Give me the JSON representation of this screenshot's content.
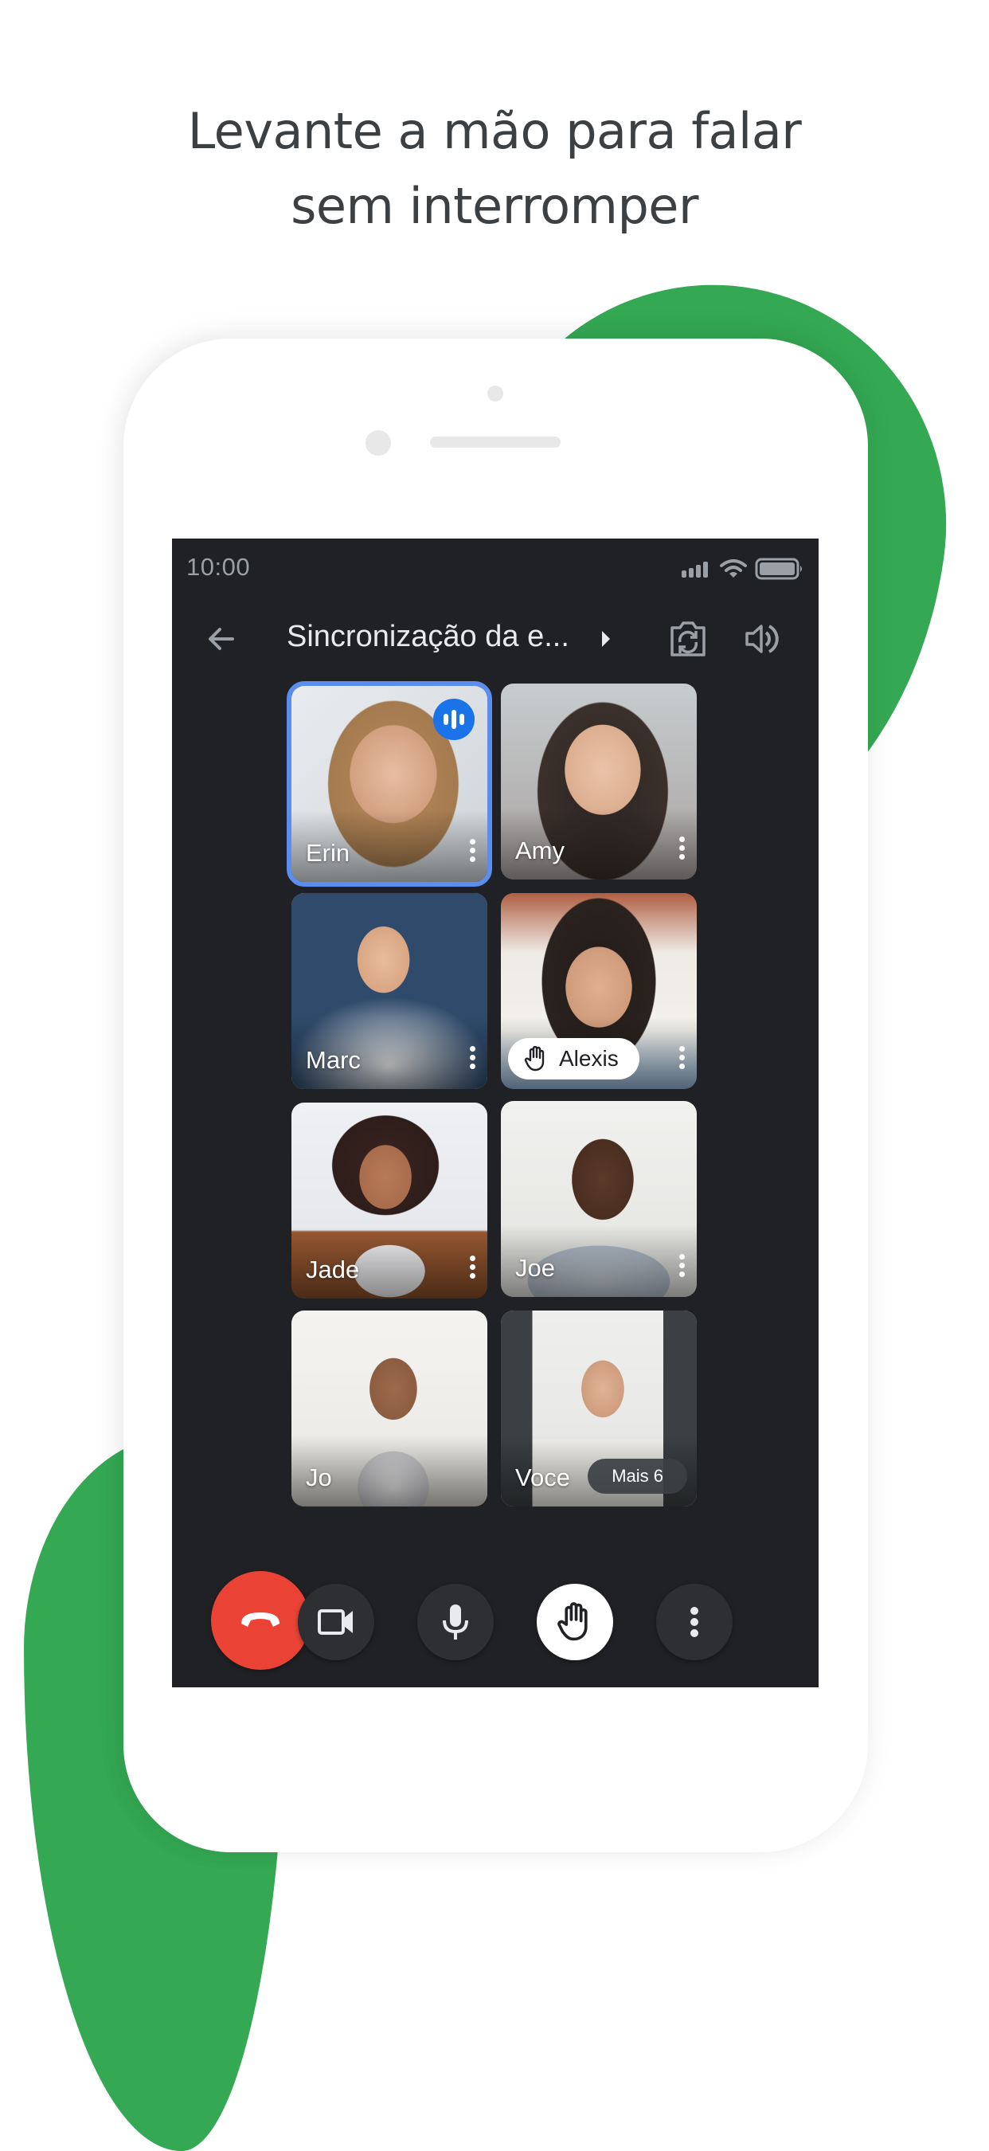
{
  "headline": {
    "line1": "Levante a mão para falar",
    "line2": "sem interromper"
  },
  "colors": {
    "brand_green": "#34a853",
    "screen_bg": "#202124",
    "speaking_blue": "#1a73e8",
    "active_outline": "#5b8def",
    "hangup_red": "#ea4335"
  },
  "status_bar": {
    "time": "10:00",
    "icons": [
      "signal-icon",
      "wifi-icon",
      "battery-icon"
    ]
  },
  "app_bar": {
    "back_icon": "arrow-back-icon",
    "meeting_title": "Sincronização da e...",
    "title_caret_icon": "caret-right-icon",
    "switch_camera_icon": "switch-camera-icon",
    "audio_output_icon": "speaker-icon"
  },
  "participants": [
    {
      "name": "Erin",
      "speaking": true,
      "hand_raised": false
    },
    {
      "name": "Amy",
      "speaking": false,
      "hand_raised": false
    },
    {
      "name": "Marc",
      "speaking": false,
      "hand_raised": false
    },
    {
      "name": "Alexis",
      "speaking": false,
      "hand_raised": true
    },
    {
      "name": "Jade",
      "speaking": false,
      "hand_raised": false
    },
    {
      "name": "Joe",
      "speaking": false,
      "hand_raised": false
    },
    {
      "name": "Jo",
      "speaking": false,
      "hand_raised": false
    },
    {
      "name": "Voce",
      "speaking": false,
      "hand_raised": false
    }
  ],
  "more_participants_label": "Mais 6",
  "controls": [
    {
      "id": "hangup",
      "icon": "call-end-icon"
    },
    {
      "id": "camera",
      "icon": "videocam-icon"
    },
    {
      "id": "microphone",
      "icon": "mic-icon"
    },
    {
      "id": "raise_hand",
      "icon": "hand-icon",
      "active": true
    },
    {
      "id": "more",
      "icon": "more-vert-icon"
    }
  ]
}
